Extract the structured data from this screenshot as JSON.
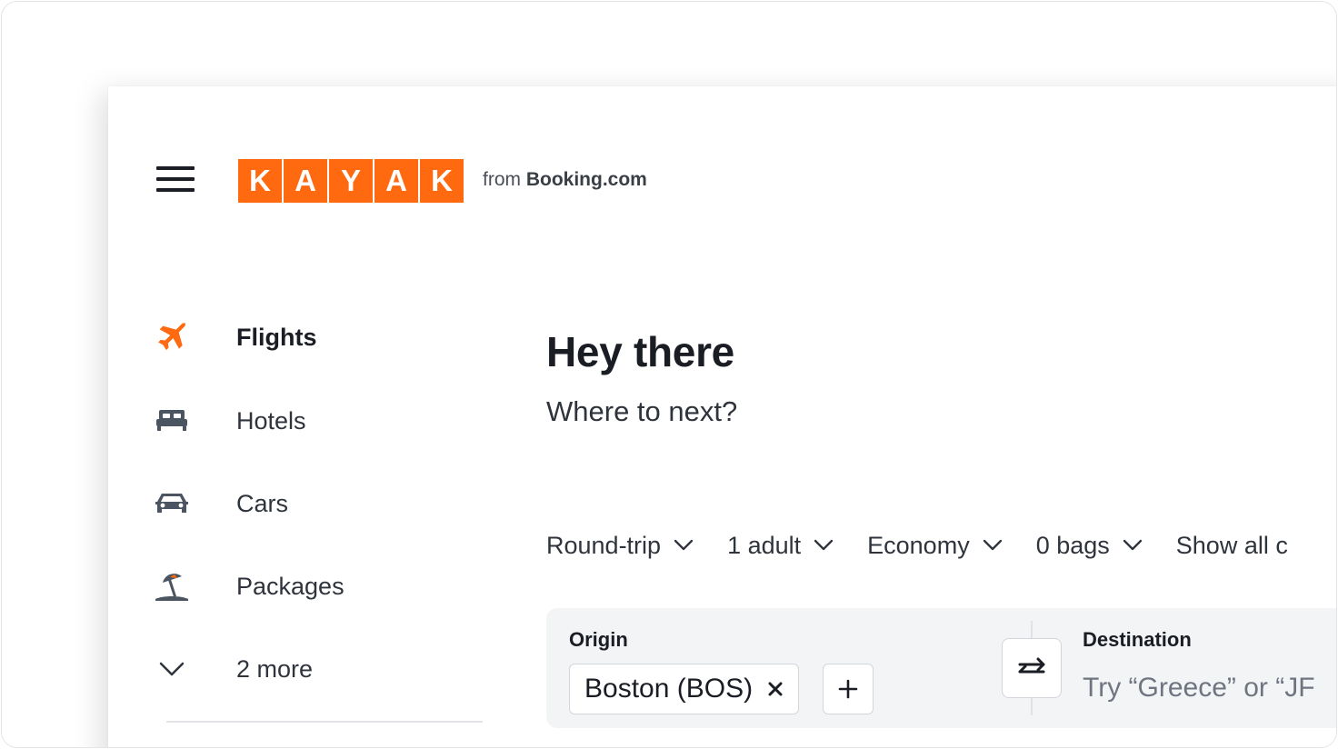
{
  "brand": {
    "logo_letters": [
      "K",
      "A",
      "Y",
      "A",
      "K"
    ],
    "from_prefix": "from",
    "from_brand": "Booking.com",
    "accent_color": "#ff690f"
  },
  "nav": {
    "items": [
      {
        "label": "Flights",
        "icon": "airplane-icon",
        "active": true
      },
      {
        "label": "Hotels",
        "icon": "bed-icon",
        "active": false
      },
      {
        "label": "Cars",
        "icon": "car-icon",
        "active": false
      },
      {
        "label": "Packages",
        "icon": "beach-umbrella-icon",
        "active": false
      }
    ],
    "more": {
      "label": "2 more",
      "icon": "chevron-down-icon"
    }
  },
  "main": {
    "greeting": "Hey there",
    "subheading": "Where to next?"
  },
  "options": {
    "trip_type": "Round-trip",
    "travelers": "1 adult",
    "cabin": "Economy",
    "bags": "0 bags",
    "show_all": "Show all c"
  },
  "search": {
    "origin_label": "Origin",
    "origin_value": "Boston (BOS)",
    "destination_label": "Destination",
    "destination_placeholder": "Try “Greece” or “JF"
  }
}
